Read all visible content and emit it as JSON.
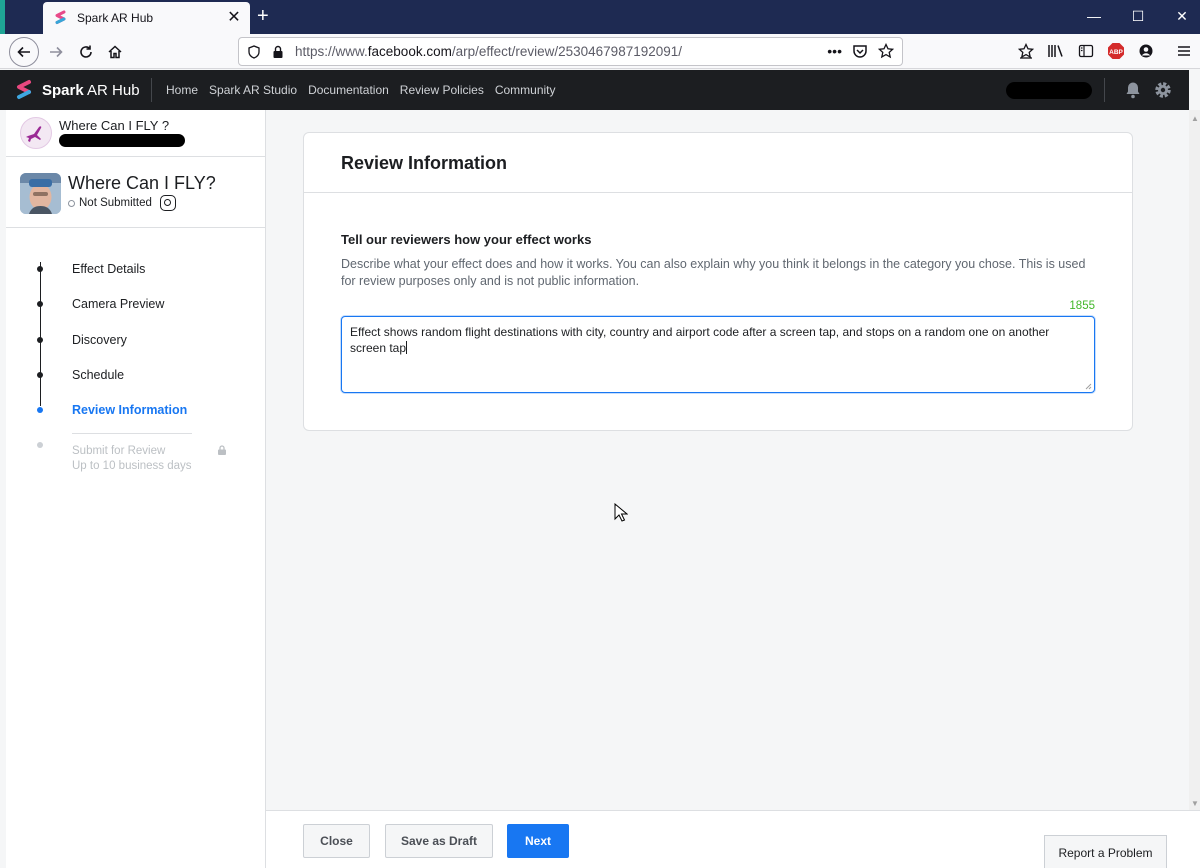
{
  "browser": {
    "tab_title": "Spark AR Hub",
    "url_prefix": "https://www.",
    "url_domain": "facebook.com",
    "url_path": "/arp/effect/review/2530467987192091/",
    "more_label": "•••",
    "colors": {
      "tabbar": "#1e2a52",
      "accent": "#1fa596"
    }
  },
  "header": {
    "brand_bold": "Spark",
    "brand_rest": " AR Hub",
    "nav": [
      "Home",
      "Spark AR Studio",
      "Documentation",
      "Review Policies",
      "Community"
    ]
  },
  "sidebar": {
    "project_title": "Where Can I FLY ?",
    "effect_title": "Where Can I FLY?",
    "effect_status": "Not Submitted",
    "steps": [
      {
        "label": "Effect Details"
      },
      {
        "label": "Camera Preview"
      },
      {
        "label": "Discovery"
      },
      {
        "label": "Schedule"
      },
      {
        "label": "Review Information",
        "active": true
      },
      {
        "label": "Submit for Review",
        "sub": "Up to 10 business days",
        "locked": true
      }
    ]
  },
  "card": {
    "title": "Review Information",
    "question": "Tell our reviewers how your effect works",
    "description": "Describe what your effect does and how it works. You can also explain why you think it belongs in the category you chose. This is used for review purposes only and is not public information.",
    "char_counter": "1855",
    "answer": "Effect shows random flight destinations with city, country and airport code after a screen tap, and stops on a random one on another screen tap"
  },
  "footer": {
    "close_label": "Close",
    "draft_label": "Save as Draft",
    "next_label": "Next",
    "report_label": "Report a Problem"
  },
  "colors": {
    "primary": "#1877f2",
    "counter": "#42b72a",
    "header_bg": "#1c1e21"
  }
}
